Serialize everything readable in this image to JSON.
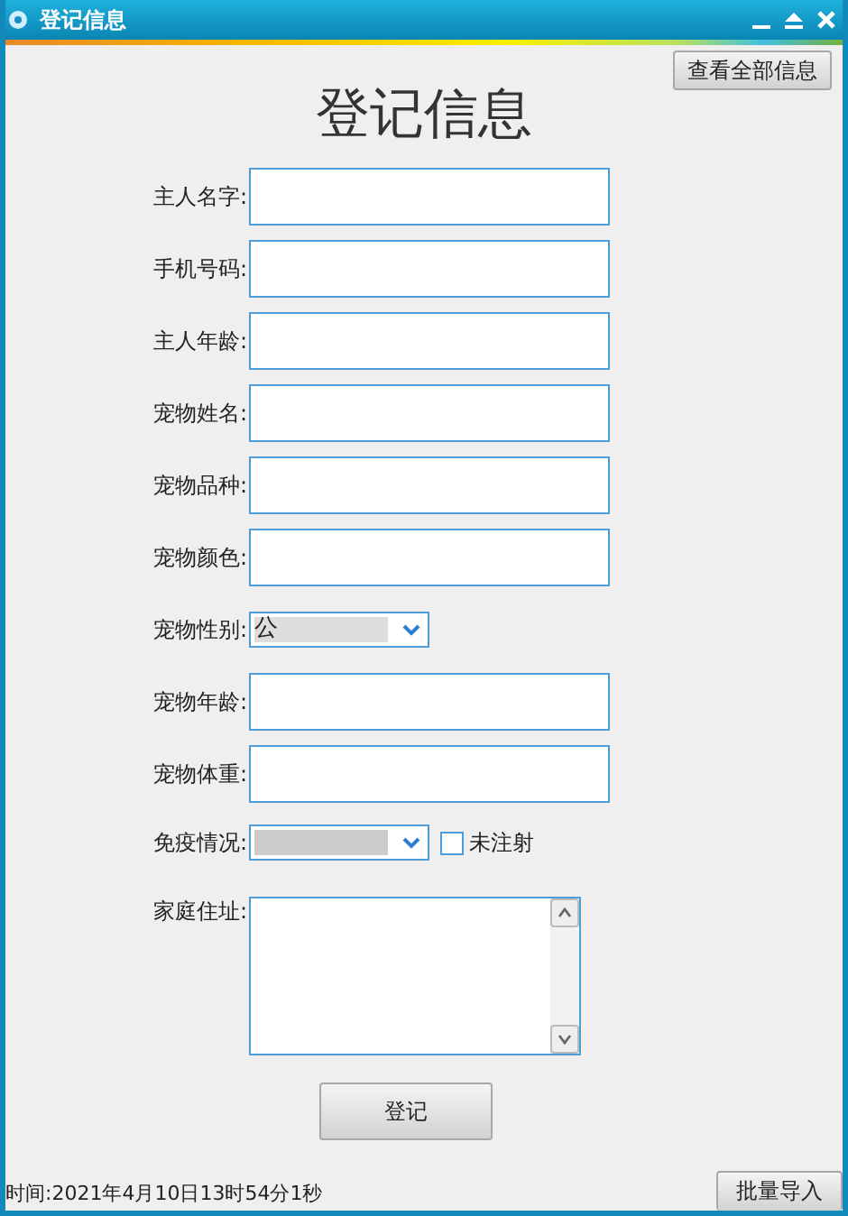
{
  "window": {
    "title": "登记信息"
  },
  "view_all_button": "查看全部信息",
  "heading": "登记信息",
  "fields": [
    {
      "kind": "text",
      "label": "主人名字:"
    },
    {
      "kind": "text",
      "label": "手机号码:"
    },
    {
      "kind": "text",
      "label": "主人年龄:"
    },
    {
      "kind": "text",
      "label": "宠物姓名:"
    },
    {
      "kind": "text",
      "label": "宠物品种:"
    },
    {
      "kind": "text",
      "label": "宠物颜色:"
    },
    {
      "kind": "select",
      "label": "宠物性别:",
      "value": "公"
    },
    {
      "kind": "text",
      "label": "宠物年龄:"
    },
    {
      "kind": "text",
      "label": "宠物体重:"
    },
    {
      "kind": "select",
      "label": "免疫情况:",
      "checkbox": {
        "label": "未注射",
        "checked": false
      }
    },
    {
      "kind": "textarea",
      "label": "家庭住址:"
    }
  ],
  "submit_button": "登记",
  "status_bar": {
    "time": "时间:2021年4月10日13时54分1秒",
    "batch_button": "批量导入"
  }
}
